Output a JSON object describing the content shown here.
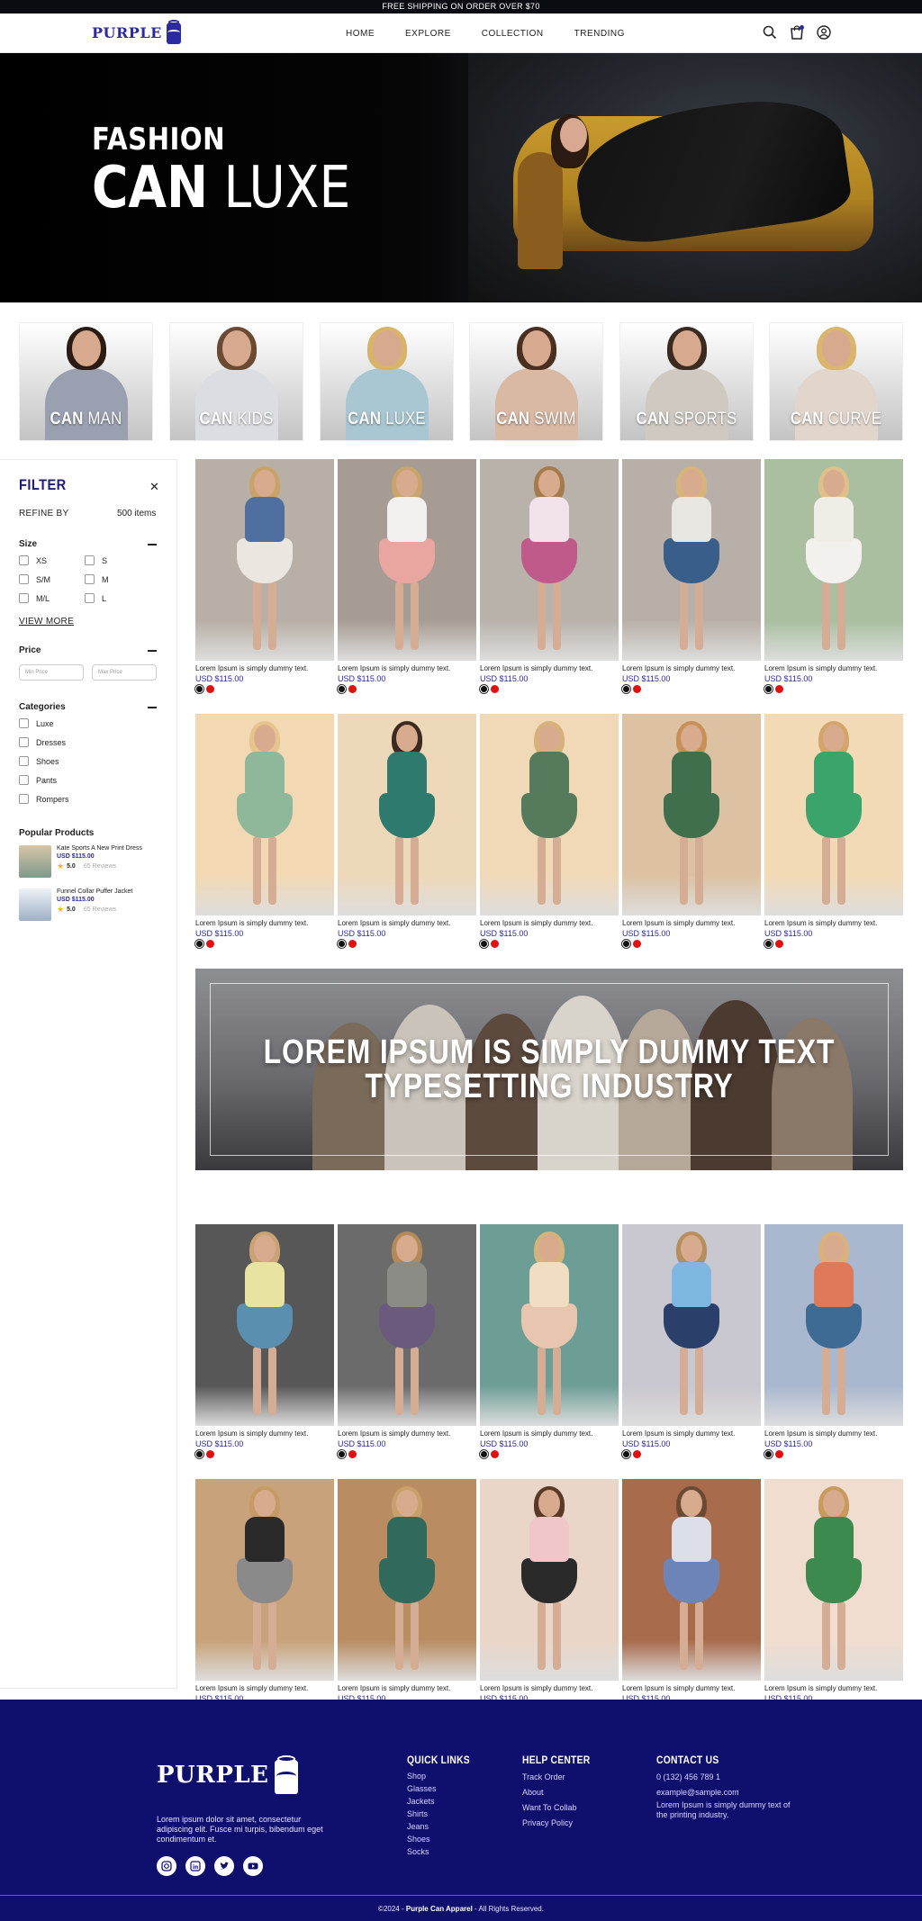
{
  "topbar": {
    "text": "FREE SHIPPING ON ORDER OVER $70"
  },
  "header": {
    "logo_text": "PURPLE",
    "nav": [
      "HOME",
      "EXPLORE",
      "COLLECTION",
      "TRENDING"
    ],
    "icons": [
      "search-icon",
      "cart-icon",
      "user-icon"
    ]
  },
  "hero": {
    "line1": "FASHION",
    "line2_bold": "CAN",
    "line2_light": "LUXE"
  },
  "categories": [
    {
      "bold": "CAN",
      "light": "MAN"
    },
    {
      "bold": "CAN",
      "light": "KIDS"
    },
    {
      "bold": "CAN",
      "light": "LUXE"
    },
    {
      "bold": "CAN",
      "light": "SWIM"
    },
    {
      "bold": "CAN",
      "light": "SPORTS"
    },
    {
      "bold": "CAN",
      "light": "CURVE"
    }
  ],
  "filter": {
    "title": "FILTER",
    "refine_label": "REFINE BY",
    "items_count": "500 items",
    "size_title": "Size",
    "sizes": [
      "XS",
      "S",
      "S/M",
      "M",
      "M/L",
      "L"
    ],
    "view_more": "VIEW MORE",
    "price_title": "Price",
    "min_placeholder": "Min Price",
    "max_placeholder": "Max Price",
    "categories_title": "Categories",
    "categories": [
      "Luxe",
      "Dresses",
      "Shoes",
      "Pants",
      "Rompers"
    ],
    "popular_title": "Popular Products",
    "popular": [
      {
        "name": "Kate Sports A New Print Dress",
        "price": "USD $115.00",
        "rating": "5.0",
        "reviews": "65 Reviews"
      },
      {
        "name": "Funnel Collar Puffer Jacket",
        "price": "USD $115.00",
        "rating": "5.0",
        "reviews": "65 Reviews"
      }
    ]
  },
  "product": {
    "desc": "Lorem Ipsum is simply dummy text.",
    "price": "USD $115.00"
  },
  "banner": {
    "line1": "LOREM IPSUM IS SIMPLY DUMMY TEXT",
    "line2": "TYPESETTING INDUSTRY"
  },
  "footer": {
    "logo_text": "PURPLE",
    "about": "Lorem ipsum dolor sit amet, consectetur adipiscing elit. Fusce mi turpis, bibendum eget condimentum et.",
    "socials": [
      "instagram-icon",
      "linkedin-icon",
      "twitter-icon",
      "youtube-icon"
    ],
    "quick_links_title": "QUICK LINKS",
    "quick_links": [
      "Shop",
      "Glasses",
      "Jackets",
      "Shirts",
      "Jeans",
      "Shoes",
      "Socks"
    ],
    "help_title": "HELP CENTER",
    "help_links": [
      "Track Order",
      "About",
      "Want To Collab",
      "Privacy Policy"
    ],
    "contact_title": "CONTACT US",
    "phone": "0 (132) 456 789 1",
    "email": "example@sample.com",
    "contact_note": "Lorem Ipsum is simply dummy text of the printing industry.",
    "copy_prefix": "©2024 - ",
    "copy_brand": "Purple Can Apparel",
    "copy_suffix": " - All Rights Reserved."
  },
  "colors": {
    "brand": "#2b2aa0",
    "footer_bg": "#0f0f6e",
    "swatch_red": "#e01010",
    "swatch_black": "#111111"
  }
}
